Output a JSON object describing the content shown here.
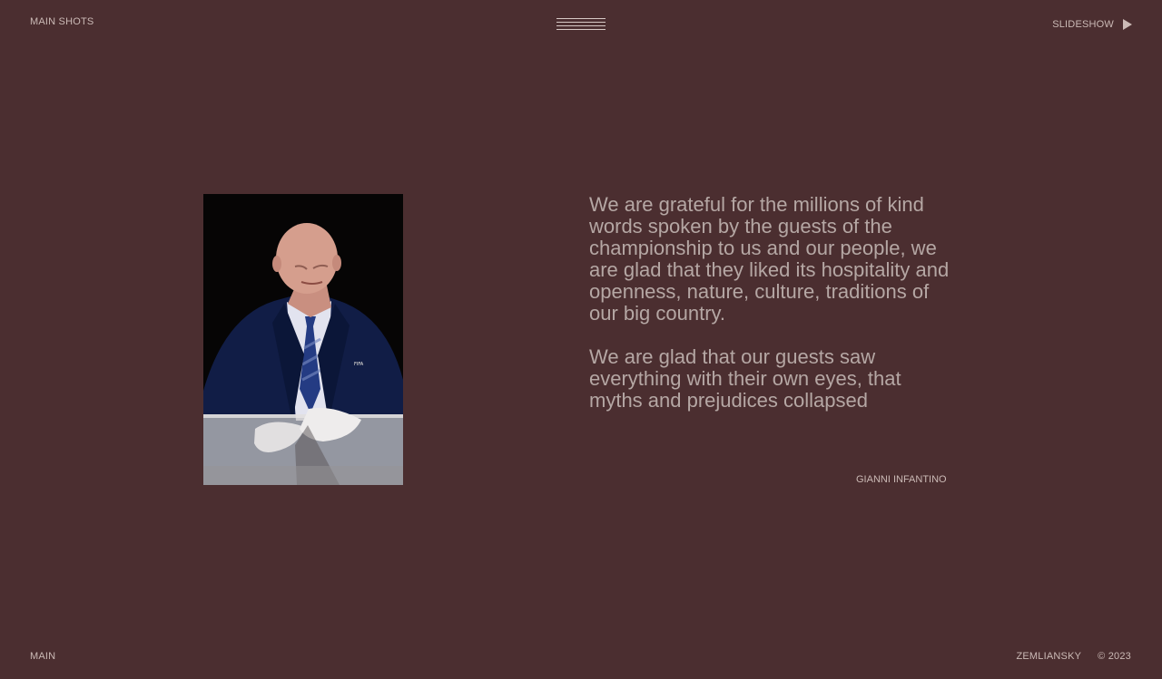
{
  "header": {
    "left_link": "MAIN SHOTS",
    "right_link": "SLIDESHOW",
    "menu_icon": "hamburger-icon",
    "play_icon": "play-icon"
  },
  "quote": {
    "paragraphs": [
      "We are grateful for the millions of kind words spoken by the guests of the championship to us and our people, we are glad that they liked its hospitality and openness, nature, culture, traditions of our big country.",
      "We are glad that our guests saw everything with their own eyes, that myths and prejudices collapsed"
    ],
    "author": "GIANNI INFANTINO"
  },
  "photo": {
    "badge_text": "FIFA"
  },
  "footer": {
    "left_link": "MAIN",
    "brand": "ZEMLIANSKY",
    "copyright": "© 2023"
  },
  "colors": {
    "background": "#4b2e30",
    "text": "#b5a7a4",
    "accent": "#cbbab6"
  }
}
